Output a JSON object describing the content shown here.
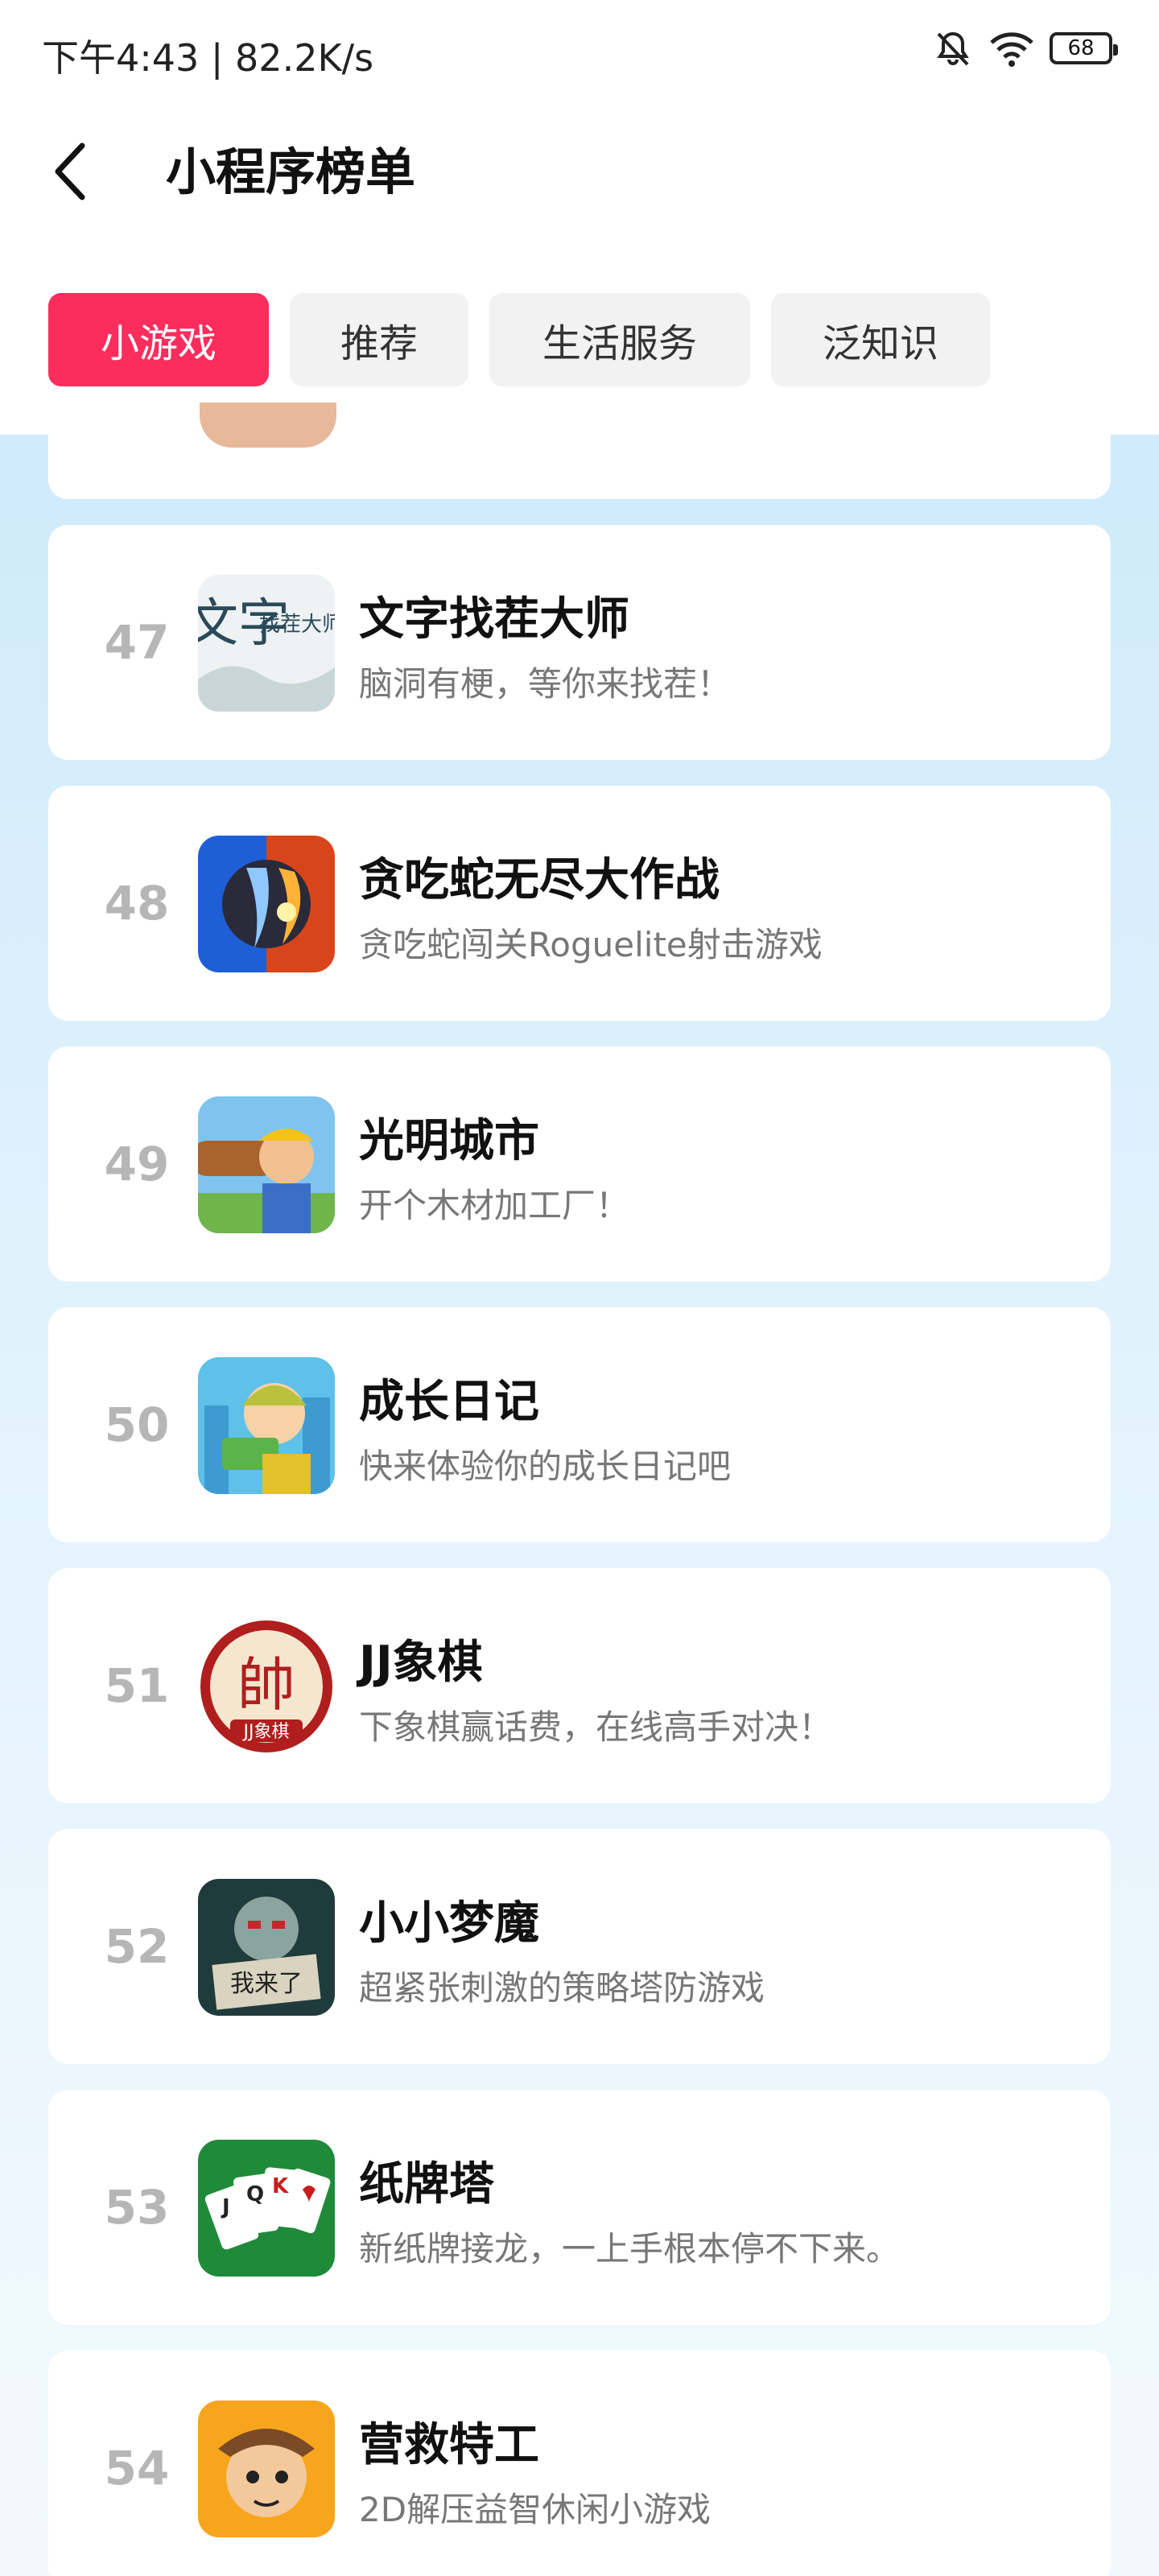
{
  "status_bar": {
    "time": "下午4:43 | 82.2K/s",
    "battery": "68"
  },
  "header": {
    "title": "小程序榜单"
  },
  "tabs": [
    {
      "label": "小游戏",
      "active": true
    },
    {
      "label": "推荐",
      "active": false
    },
    {
      "label": "生活服务",
      "active": false
    },
    {
      "label": "泛知识",
      "active": false
    }
  ],
  "items": [
    {
      "rank": "47",
      "name": "文字找茬大师",
      "desc": "脑洞有梗，等你来找茬！"
    },
    {
      "rank": "48",
      "name": "贪吃蛇无尽大作战",
      "desc": "贪吃蛇闯关Roguelite射击游戏"
    },
    {
      "rank": "49",
      "name": "光明城市",
      "desc": "开个木材加工厂！"
    },
    {
      "rank": "50",
      "name": "成长日记",
      "desc": "快来体验你的成长日记吧"
    },
    {
      "rank": "51",
      "name": "JJ象棋",
      "desc": "下象棋赢话费，在线高手对决！"
    },
    {
      "rank": "52",
      "name": "小小梦魔",
      "desc": "超紧张刺激的策略塔防游戏"
    },
    {
      "rank": "53",
      "name": "纸牌塔",
      "desc": "新纸牌接龙，一上手根本停不下来。"
    },
    {
      "rank": "54",
      "name": "营救特工",
      "desc": "2D解压益智休闲小游戏"
    }
  ],
  "icon_art": {
    "47": {
      "text_main": "文字",
      "text_side": "找茬大师"
    },
    "51": {
      "text_main": "帥",
      "text_sub": "JJ象棋"
    },
    "52": {
      "text_sub": "我来了"
    }
  }
}
